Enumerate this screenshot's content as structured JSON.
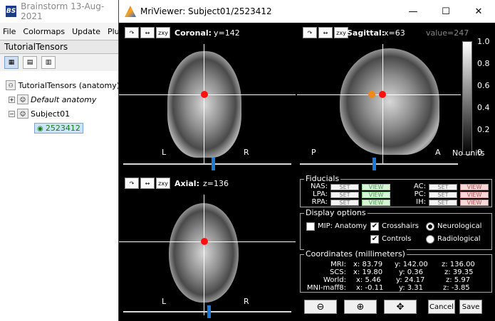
{
  "bs": {
    "title": "Brainstorm 13-Aug-2021",
    "logo": "BS",
    "menu": [
      "File",
      "Colormaps",
      "Update",
      "Plug"
    ],
    "protocol": "TutorialTensors",
    "tree": {
      "root": "TutorialTensors (anatomy)",
      "default_anatomy": "Default anatomy",
      "subject": "Subject01",
      "mri": "2523412"
    }
  },
  "mri": {
    "title": "MriViewer: Subject01/2523412",
    "window_buttons": {
      "minimize": "—",
      "maximize": "☐",
      "close": "✕"
    },
    "toolbar_buttons": [
      "↷",
      "↔",
      "zxy"
    ],
    "coronal": {
      "label": "Coronal:",
      "coord": "y=142",
      "left": "L",
      "right": "R"
    },
    "sagittal": {
      "label": "Sagittal:",
      "coord": "x=63",
      "value": "value=247",
      "left": "P",
      "right": "A"
    },
    "axial": {
      "label": "Axial:",
      "coord": "z=136",
      "left": "L",
      "right": "R"
    },
    "colorbar": {
      "ticks": [
        "1.0",
        "0.8",
        "0.6",
        "0.4",
        "0.2",
        "0"
      ],
      "units": "No units"
    },
    "fiducials": {
      "title": "Fiducials",
      "left": [
        {
          "name": "NAS:",
          "set": "SET",
          "view": "VIEW"
        },
        {
          "name": "LPA:",
          "set": "SET",
          "view": "VIEW"
        },
        {
          "name": "RPA:",
          "set": "SET",
          "view": "VIEW"
        }
      ],
      "right": [
        {
          "name": "AC:",
          "set": "SET",
          "view": "VIEW"
        },
        {
          "name": "PC:",
          "set": "SET",
          "view": "VIEW"
        },
        {
          "name": "IH:",
          "set": "SET",
          "view": "VIEW"
        }
      ]
    },
    "display_options": {
      "title": "Display options",
      "mip_anatomy": {
        "label": "MIP: Anatomy",
        "checked": false
      },
      "crosshairs": {
        "label": "Crosshairs",
        "checked": true
      },
      "controls": {
        "label": "Controls",
        "checked": true
      },
      "neurological": {
        "label": "Neurological",
        "selected": true
      },
      "radiological": {
        "label": "Radiological",
        "selected": false
      }
    },
    "coordinates": {
      "title": "Coordinates (millimeters)",
      "rows": [
        {
          "name": "MRI:",
          "x": "x: 83.79",
          "y": "y: 142.00",
          "z": "z: 136.00"
        },
        {
          "name": "SCS:",
          "x": "x: 19.80",
          "y": "y: 0.36",
          "z": "z: 39.35"
        },
        {
          "name": "World:",
          "x": "x: 5.46",
          "y": "y: 24.17",
          "z": "z: 5.97"
        },
        {
          "name": "MNI-maff8:",
          "x": "x: -0.11",
          "y": "y: 3.31",
          "z": "z: -3.85"
        }
      ]
    },
    "buttons": {
      "zoom_out": "⊖",
      "zoom_in": "⊕",
      "pan": "✥",
      "cancel": "Cancel",
      "save": "Save"
    }
  }
}
